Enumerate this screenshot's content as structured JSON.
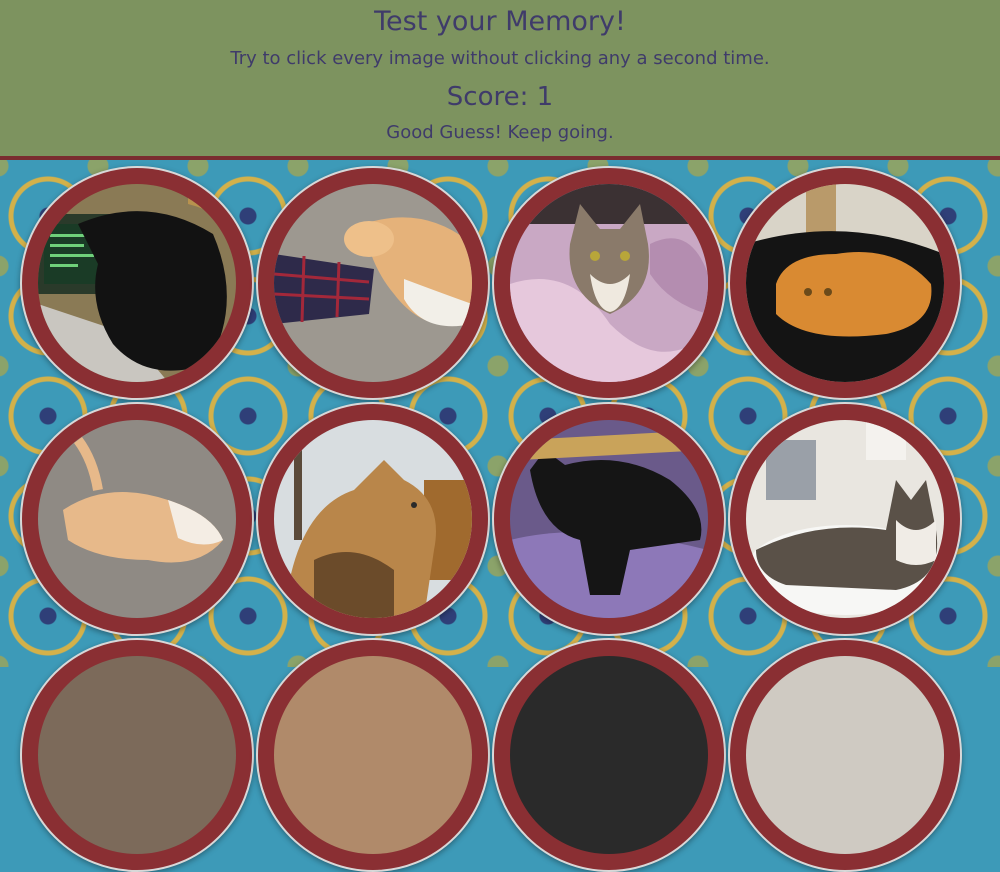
{
  "header": {
    "title": "Test your Memory!",
    "instructions": "Try to click every image without clicking any a second time.",
    "score": "Score: 1",
    "message": "Good Guess! Keep going."
  },
  "colors": {
    "header_bg": "#7d935f",
    "header_text": "#3f3b6a",
    "header_border": "#7a2b2f",
    "card_ring": "#8a2f33",
    "pattern_bg": "#3d9ab8"
  },
  "cards": [
    {
      "subject": "black cat on laptop keyboard"
    },
    {
      "subject": "orange cat on carpet beside plaid bag"
    },
    {
      "subject": "tabby cat on pink blanket"
    },
    {
      "subject": "orange long-haired cat on black cushion"
    },
    {
      "subject": "orange cat lying on grey carpet"
    },
    {
      "subject": "long-haired orange cat by window"
    },
    {
      "subject": "black cat on purple blanket"
    },
    {
      "subject": "tabby cat in bathroom sink"
    },
    {
      "subject": "partially visible cat photo"
    },
    {
      "subject": "partially visible cat photo"
    },
    {
      "subject": "partially visible cat photo"
    },
    {
      "subject": "partially visible cat photo"
    }
  ]
}
